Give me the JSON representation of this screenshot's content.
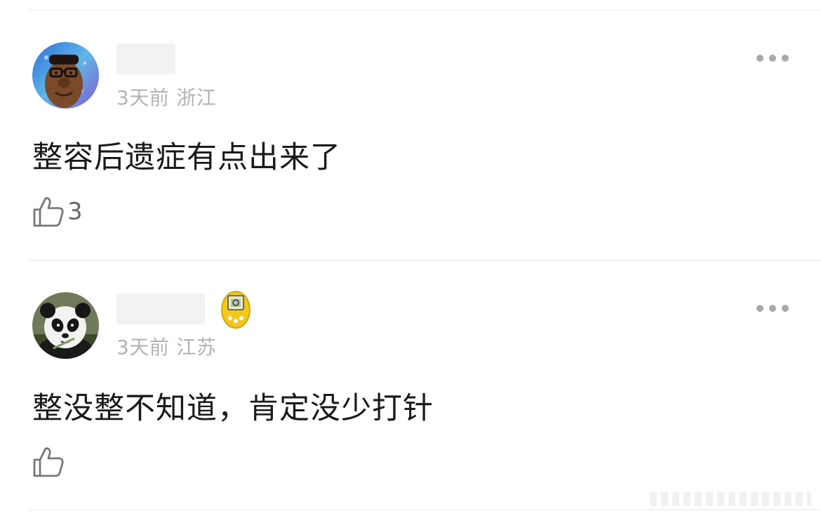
{
  "comments": [
    {
      "avatar_icon": "cartoon-man-with-glasses-avatar",
      "time": "3天前",
      "location": "浙江",
      "text": "整容后遗症有点出来了",
      "likes": "3",
      "more_icon": "more-options-icon"
    },
    {
      "avatar_icon": "panda-avatar",
      "badge_icon": "tamagotchi-badge-icon",
      "time": "3天前",
      "location": "江苏",
      "text": "整没整不知道，肯定没少打针",
      "likes": "",
      "more_icon": "more-options-icon"
    }
  ],
  "colors": {
    "meta_text": "#b3b3b3",
    "body_text": "#1a1a1a",
    "divider": "#e6e6e6",
    "badge_yellow": "#f2c81a"
  }
}
